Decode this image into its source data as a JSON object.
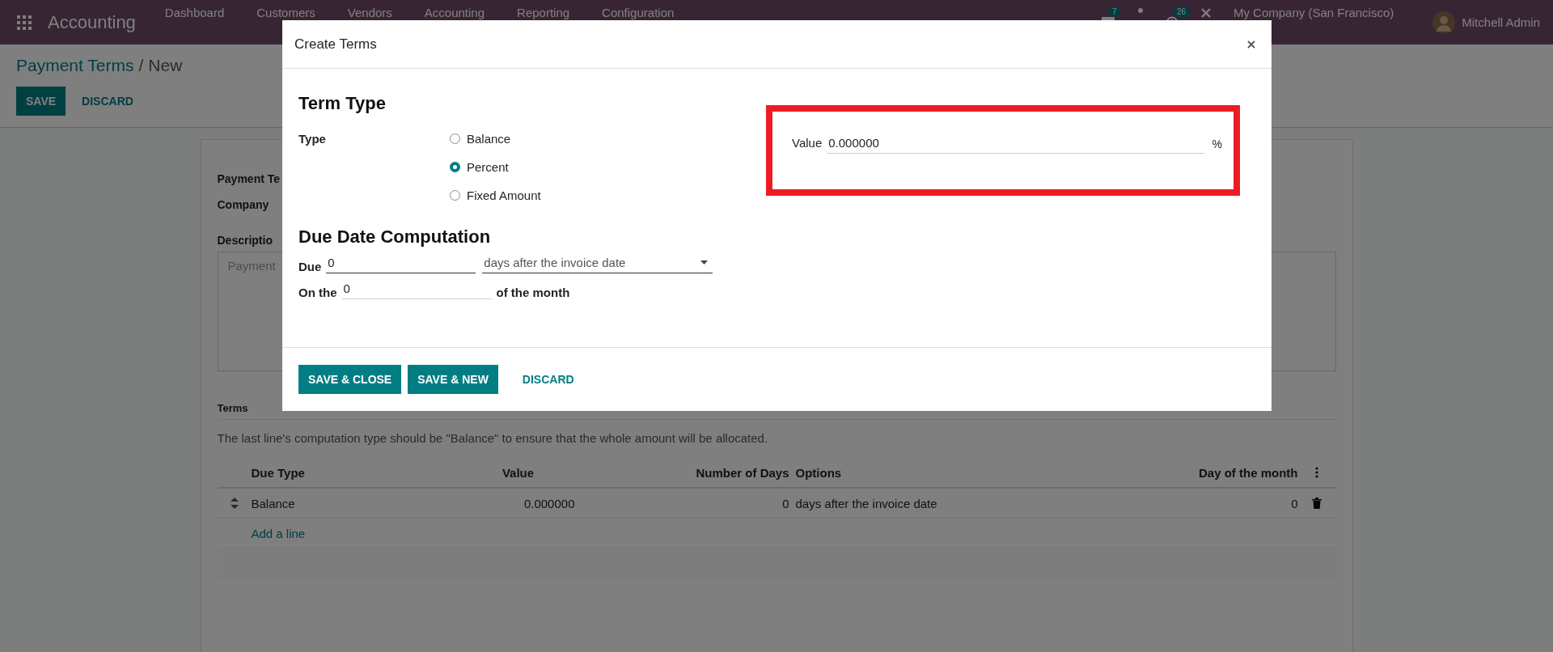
{
  "topbar": {
    "app_name": "Accounting",
    "menu": [
      "Dashboard",
      "Customers",
      "Vendors",
      "Accounting",
      "Reporting",
      "Configuration"
    ],
    "messages_badge": "7",
    "activities_badge": "26",
    "company": "My Company (San Francisco)",
    "user": "Mitchell Admin"
  },
  "breadcrumb": {
    "parent": "Payment Terms",
    "separator": "/",
    "current": "New"
  },
  "actions": [
    {
      "label": "SAVE",
      "kind": "primary"
    },
    {
      "label": "DISCARD",
      "kind": "link"
    }
  ],
  "form": {
    "fields": [
      "Payment Te",
      "Company",
      "Descriptio"
    ],
    "description_placeholder": "Payment",
    "terms_label": "Terms",
    "note": "The last line's computation type should be \"Balance\" to ensure that the whole amount will be allocated.",
    "columns": [
      "Due Type",
      "Value",
      "Number of Days",
      "Options",
      "Day of the month"
    ],
    "rows": [
      {
        "due_type": "Balance",
        "value": "0.000000",
        "days": "0",
        "options": "days after the invoice date",
        "day_of_month": "0"
      }
    ],
    "add_line": "Add a line"
  },
  "dialog": {
    "title": "Create Terms",
    "term_type_heading": "Term Type",
    "type_label": "Type",
    "types": [
      {
        "label": "Balance",
        "selected": false
      },
      {
        "label": "Percent",
        "selected": true
      },
      {
        "label": "Fixed Amount",
        "selected": false
      }
    ],
    "due_heading": "Due Date Computation",
    "due_label": "Due",
    "due_value": "0",
    "due_option": "days after the invoice date",
    "on_the_label": "On the",
    "on_the_value": "0",
    "of_month": "of the month",
    "value_label": "Value",
    "value": "0.000000",
    "value_unit": "%",
    "buttons": [
      {
        "label": "SAVE & CLOSE",
        "kind": "primary"
      },
      {
        "label": "SAVE & NEW",
        "kind": "primary"
      },
      {
        "label": "DISCARD",
        "kind": "link"
      }
    ]
  }
}
